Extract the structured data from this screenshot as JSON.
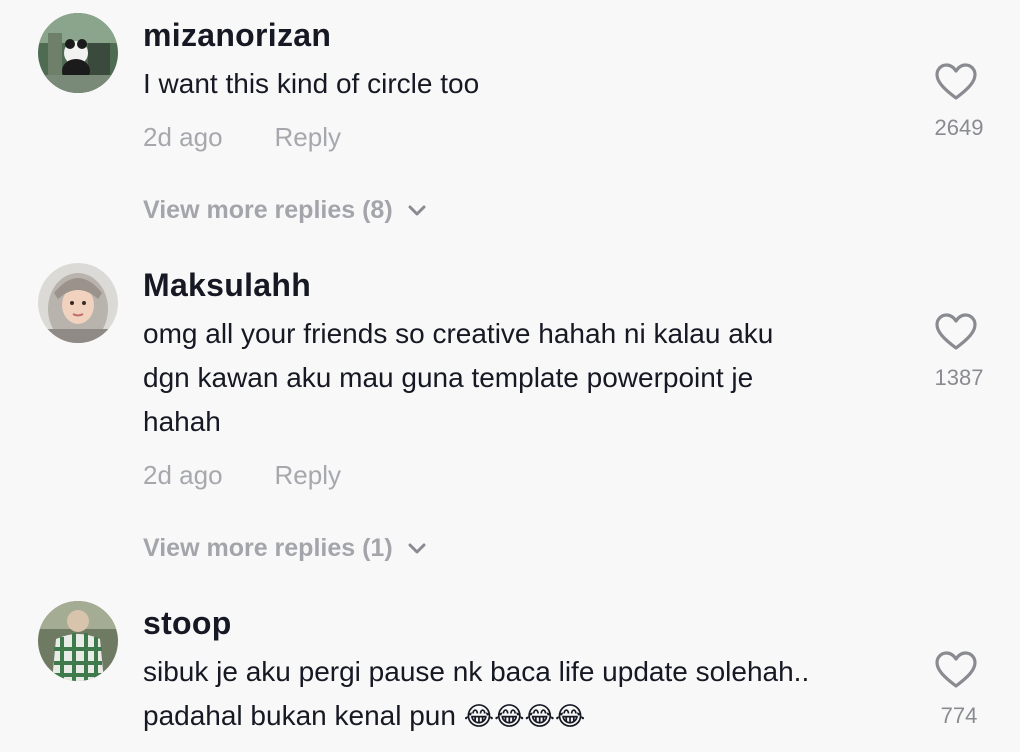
{
  "comments": [
    {
      "username": "mizanorizan",
      "text": "I want this kind of circle too",
      "time": "2d ago",
      "reply_label": "Reply",
      "likes": "2649",
      "more_replies": "View more replies (8)",
      "avatar_icon": "panda-photo-avatar"
    },
    {
      "username": "Maksulahh",
      "text_lines": [
        "omg all your friends so creative hahah ni kalau aku",
        "dgn kawan aku mau guna template powerpoint je",
        "hahah"
      ],
      "time": "2d ago",
      "reply_label": "Reply",
      "likes": "1387",
      "more_replies": "View more replies (1)",
      "avatar_icon": "hijab-girl-photo-avatar"
    },
    {
      "username": "stoop",
      "text_lines": [
        "sibuk je aku pergi pause nk baca life update solehah..",
        "padahal bukan kenal pun "
      ],
      "emoji": "😂😂😂😂",
      "likes": "774",
      "avatar_icon": "plaid-shirt-photo-avatar"
    }
  ],
  "icons": {
    "like": "heart-outline-icon",
    "expand": "chevron-down-icon"
  },
  "colors": {
    "background": "#f8f8f8",
    "primary_text": "#161823",
    "secondary_text": "#a7a8ad",
    "icon": "#8a8b91"
  }
}
